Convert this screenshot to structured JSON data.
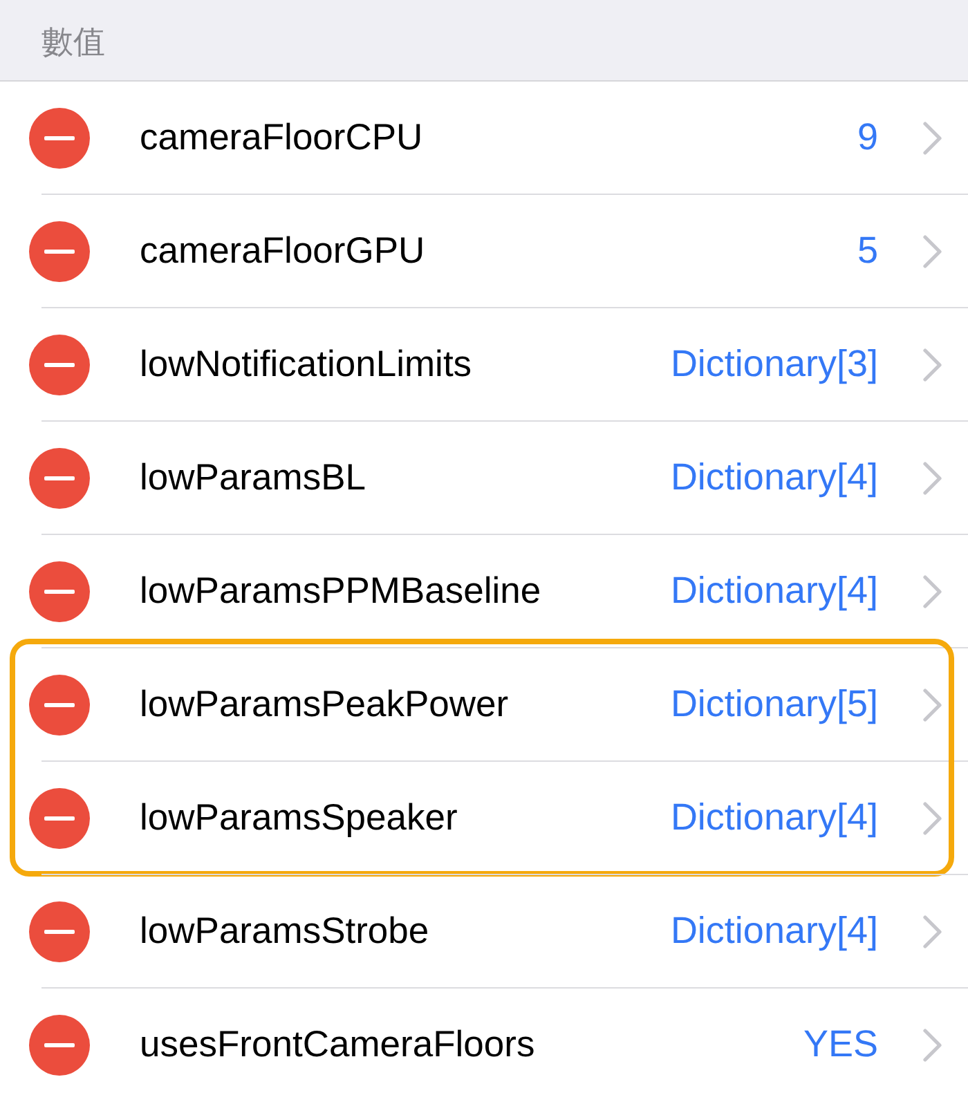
{
  "section": {
    "title": "數值"
  },
  "rows": [
    {
      "key": "cameraFloorCPU",
      "value": "9",
      "highlighted": false
    },
    {
      "key": "cameraFloorGPU",
      "value": "5",
      "highlighted": false
    },
    {
      "key": "lowNotificationLimits",
      "value": "Dictionary[3]",
      "highlighted": false
    },
    {
      "key": "lowParamsBL",
      "value": "Dictionary[4]",
      "highlighted": false
    },
    {
      "key": "lowParamsPPMBaseline",
      "value": "Dictionary[4]",
      "highlighted": false
    },
    {
      "key": "lowParamsPeakPower",
      "value": "Dictionary[5]",
      "highlighted": true
    },
    {
      "key": "lowParamsSpeaker",
      "value": "Dictionary[4]",
      "highlighted": true
    },
    {
      "key": "lowParamsStrobe",
      "value": "Dictionary[4]",
      "highlighted": false
    },
    {
      "key": "usesFrontCameraFloors",
      "value": "YES",
      "highlighted": false
    }
  ]
}
